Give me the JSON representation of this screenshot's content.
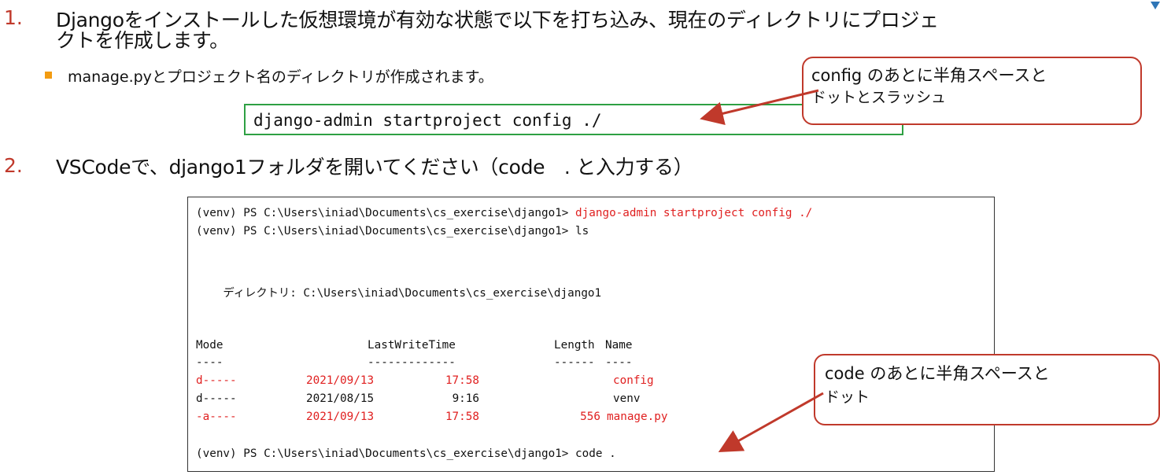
{
  "steps": [
    {
      "number": "1.",
      "line1": "Djangoをインストールした仮想環境が有効な状態で以下を打ち込み、現在のディレクトリにプロジェ",
      "line2": "クトを作成します。",
      "bullet": "manage.pyとプロジェクト名のディレクトリが作成されます。",
      "command": "django-admin startproject config ./"
    },
    {
      "number": "2.",
      "text": "VSCodeで、django1フォルダを開いてください（code　. と入力する）"
    }
  ],
  "callouts": [
    {
      "line1": "config のあとに半角スペースと",
      "line2": "ドットとスラッシュ"
    },
    {
      "line1": "code のあとに半角スペースと",
      "line2": "ドット"
    }
  ],
  "terminal": {
    "prompt": "(venv) PS C:\\Users\\iniad\\Documents\\cs_exercise\\django1>",
    "cmd1": " django-admin startproject config ./",
    "cmd2": " ls",
    "cmd3": " code .",
    "directory_line": "    ディレクトリ: C:\\Users\\iniad\\Documents\\cs_exercise\\django1",
    "headers": {
      "mode": "Mode",
      "lastwrite": "LastWriteTime",
      "length": "Length",
      "name": "Name"
    },
    "header_dashes": {
      "mode": "----",
      "lastwrite": "-------------",
      "length": "------",
      "name": "----"
    },
    "rows": [
      {
        "mode": "d-----",
        "date": "2021/09/13",
        "time": "17:58",
        "length": "",
        "name": "config",
        "highlight": true
      },
      {
        "mode": "d-----",
        "date": "2021/08/15",
        "time": "9:16",
        "length": "",
        "name": "venv",
        "highlight": false
      },
      {
        "mode": "-a----",
        "date": "2021/09/13",
        "time": "17:58",
        "length": "556",
        "name": "manage.py",
        "highlight": true
      }
    ]
  },
  "colors": {
    "accent_red": "#c0392b",
    "terminal_red": "#e02020",
    "box_green": "#2ea043",
    "bullet_orange": "#f39c12",
    "corner_blue": "#2e75b6"
  }
}
